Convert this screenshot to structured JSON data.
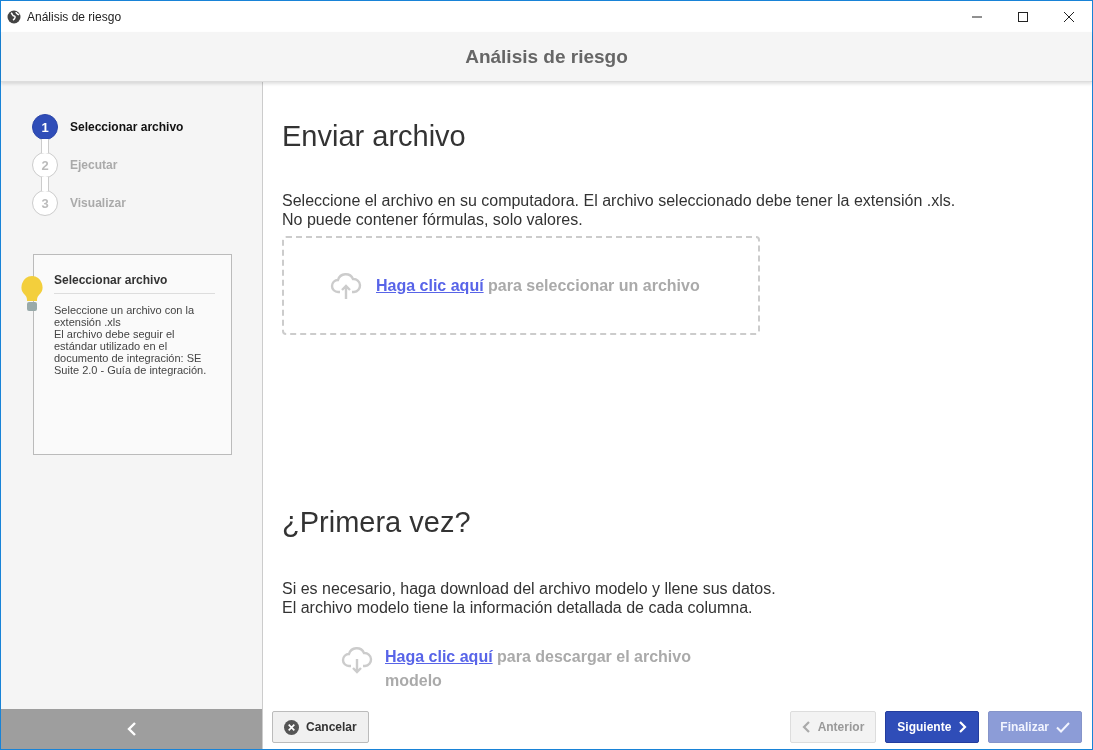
{
  "window": {
    "title": "Análisis de riesgo"
  },
  "header": {
    "title": "Análisis de riesgo"
  },
  "steps": [
    {
      "number": "1",
      "label": "Seleccionar archivo",
      "selected": true
    },
    {
      "number": "2",
      "label": "Ejecutar",
      "selected": false
    },
    {
      "number": "3",
      "label": "Visualizar",
      "selected": false
    }
  ],
  "help": {
    "title": "Seleccionar archivo",
    "lines": [
      "Seleccione un archivo con la extensión .xls",
      "El archivo debe seguir el estándar utilizado en el documento de integración: SE Suite 2.0 - Guía de integración."
    ]
  },
  "upload": {
    "title": "Enviar archivo",
    "description": [
      "Seleccione el archivo en su computadora. El archivo seleccionado debe tener la extensión .xls.",
      "No puede contener fórmulas, solo valores."
    ],
    "link": "Haga clic aquí",
    "text": "para seleccionar un archivo"
  },
  "first_time": {
    "title": "¿Primera vez?",
    "description": [
      "Si es necesario, haga download del archivo modelo y llene sus datos.",
      "El archivo modelo tiene la información detallada de cada columna."
    ],
    "link": "Haga clic aquí",
    "text": "para descargar el archivo modelo"
  },
  "buttons": [
    {
      "label": "Cancelar",
      "kind": "cancel",
      "disabled": false
    },
    {
      "label": "Anterior",
      "kind": "back",
      "disabled": true
    },
    {
      "label": "Siguiente",
      "kind": "next",
      "disabled": false
    },
    {
      "label": "Finalizar",
      "kind": "finish",
      "disabled": true
    }
  ]
}
